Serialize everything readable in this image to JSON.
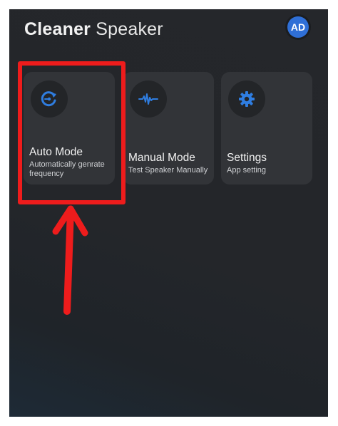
{
  "app": {
    "title_bold": "Cleaner",
    "title_light": "Speaker",
    "ad_badge": "AD"
  },
  "cards": [
    {
      "label": "Auto Mode",
      "sub": "Automatically genrate frequency",
      "icon": "auto-refresh-icon"
    },
    {
      "label": "Manual Mode",
      "sub": "Test Speaker Manually",
      "icon": "waveform-icon"
    },
    {
      "label": "Settings",
      "sub": "App setting",
      "icon": "gear-icon"
    }
  ],
  "colors": {
    "accent": "#2f7de0",
    "highlight": "#ee1c1c",
    "card": "#323438",
    "background": "#25272b"
  }
}
